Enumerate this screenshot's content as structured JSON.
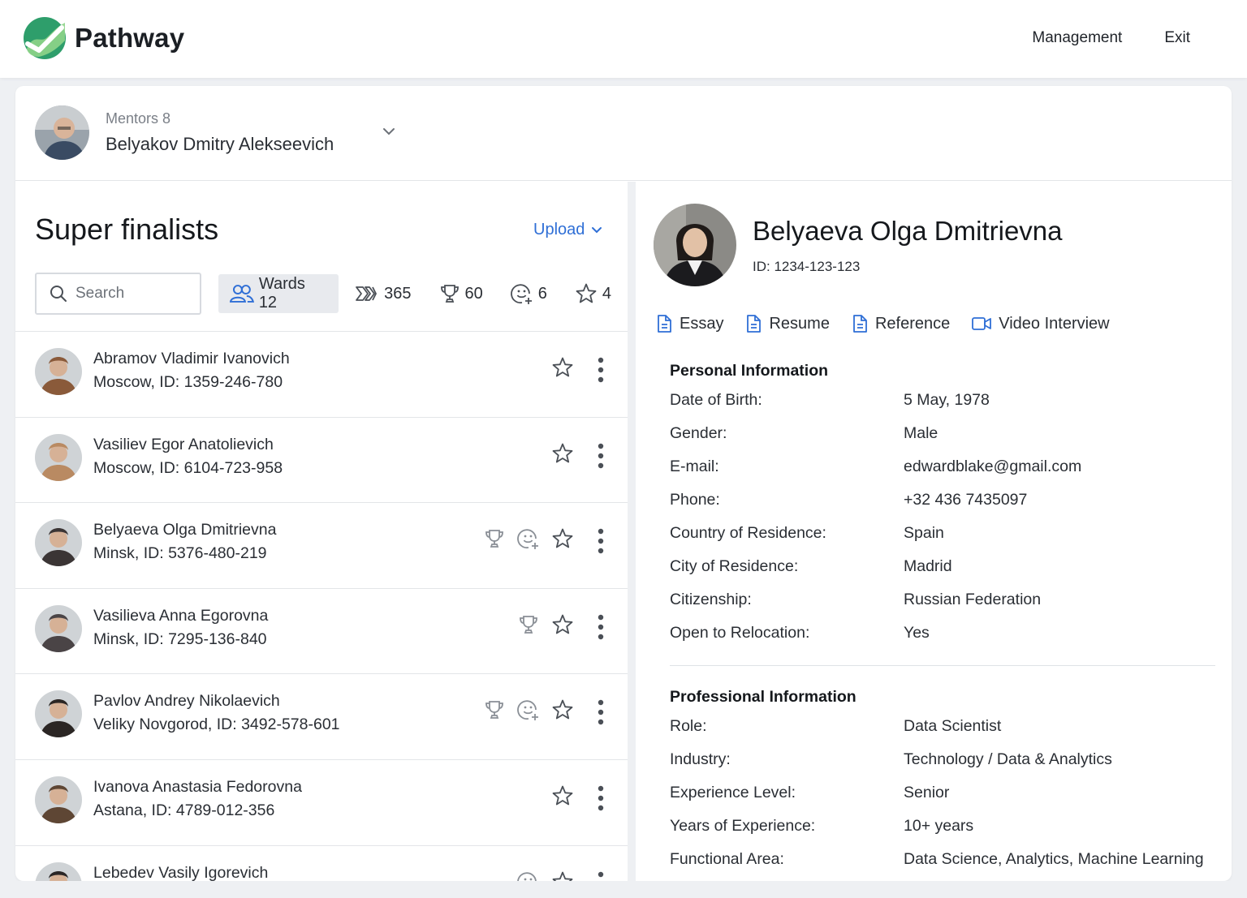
{
  "app": {
    "brand": "Pathway",
    "accent": "#2f6fd6",
    "logo_colors": [
      "#2e9e6b",
      "#57c27d",
      "#8fd48a"
    ]
  },
  "topnav": {
    "management": "Management",
    "exit": "Exit"
  },
  "mentor": {
    "count_label": "Mentors 8",
    "name": "Belyakov Dmitry Alekseevich",
    "dropdown_icon": "chevron-down-icon"
  },
  "list_panel": {
    "title": "Super finalists",
    "upload_label": "Upload",
    "search_placeholder": "Search",
    "filters": [
      {
        "icon": "users-icon",
        "label": "Wards 12",
        "active": true
      },
      {
        "icon": "chevrons-icon",
        "label": "365",
        "active": false
      },
      {
        "icon": "trophy-icon",
        "label": "60",
        "active": false
      },
      {
        "icon": "smile-plus-icon",
        "label": "6",
        "active": false
      },
      {
        "icon": "star-icon",
        "label": "4",
        "active": false
      }
    ],
    "rows": [
      {
        "name": "Abramov Vladimir Ivanovich",
        "meta": "Moscow, ID: 1359-246-780",
        "trophy": false,
        "smile": false,
        "avatar_color": "#8a5a3a"
      },
      {
        "name": "Vasiliev Egor Anatolievich",
        "meta": "Moscow, ID: 6104-723-958",
        "trophy": false,
        "smile": false,
        "avatar_color": "#b98a62"
      },
      {
        "name": "Belyaeva Olga Dmitrievna",
        "meta": "Minsk, ID: 5376-480-219",
        "trophy": true,
        "smile": true,
        "avatar_color": "#3b3535"
      },
      {
        "name": "Vasilieva Anna Egorovna",
        "meta": "Minsk, ID: 7295-136-840",
        "trophy": true,
        "smile": false,
        "avatar_color": "#4a4446"
      },
      {
        "name": "Pavlov Andrey Nikolaevich",
        "meta": "Veliky Novgorod, ID: 3492-578-601",
        "trophy": true,
        "smile": true,
        "avatar_color": "#2b2624"
      },
      {
        "name": "Ivanova Anastasia Fedorovna",
        "meta": "Astana, ID: 4789-012-356",
        "trophy": false,
        "smile": false,
        "avatar_color": "#5e4634"
      },
      {
        "name": "Lebedev Vasily Igorevich",
        "meta": "",
        "trophy": false,
        "smile": true,
        "avatar_color": "#2a2626"
      }
    ]
  },
  "profile": {
    "name": "Belyaeva Olga Dmitrievna",
    "id_line": "ID: 1234-123-123",
    "docs": [
      {
        "icon": "file-icon",
        "label": "Essay"
      },
      {
        "icon": "file-icon",
        "label": "Resume"
      },
      {
        "icon": "file-icon",
        "label": "Reference"
      },
      {
        "icon": "video-icon",
        "label": "Video Interview"
      }
    ],
    "personal": {
      "heading": "Personal Information",
      "rows": [
        {
          "label": "Date of Birth:",
          "value": "5 May, 1978"
        },
        {
          "label": "Gender:",
          "value": "Male"
        },
        {
          "label": "E-mail:",
          "value": "edwardblake@gmail.com"
        },
        {
          "label": "Phone:",
          "value": "+32 436 7435097"
        },
        {
          "label": "Country of Residence:",
          "value": "Spain"
        },
        {
          "label": "City of Residence:",
          "value": "Madrid"
        },
        {
          "label": "Citizenship:",
          "value": "Russian Federation"
        },
        {
          "label": "Open to Relocation:",
          "value": "Yes"
        }
      ]
    },
    "professional": {
      "heading": "Professional Information",
      "rows": [
        {
          "label": "Role:",
          "value": "Data Scientist"
        },
        {
          "label": "Industry:",
          "value": "Technology / Data & Analytics"
        },
        {
          "label": "Experience Level:",
          "value": "Senior"
        },
        {
          "label": "Years of Experience:",
          "value": "10+ years"
        },
        {
          "label": "Functional Area:",
          "value": "Data Science, Analytics, Machine Learning"
        }
      ]
    }
  }
}
